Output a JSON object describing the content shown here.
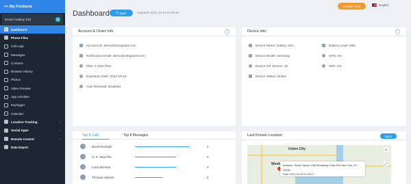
{
  "sidebar": {
    "back_label": "<< My Products",
    "device_name": "Device Galaxy S10",
    "items": [
      {
        "label": "Dashboard",
        "active": true,
        "bold": true,
        "arrow": false,
        "icon": "dashboard-icon"
      },
      {
        "label": "Phone Files",
        "bold": true,
        "arrow": true,
        "icon": "phone-files-icon"
      },
      {
        "label": "Call Logs",
        "icon": "call-icon"
      },
      {
        "label": "Messages",
        "icon": "message-icon"
      },
      {
        "label": "Contacts",
        "icon": "contacts-icon"
      },
      {
        "label": "Browser History",
        "icon": "browser-icon"
      },
      {
        "label": "Photos",
        "icon": "photo-icon"
      },
      {
        "label": "Video Preview",
        "icon": "video-icon"
      },
      {
        "label": "App Activities",
        "icon": "apps-icon"
      },
      {
        "label": "Keylogger",
        "icon": "keyboard-icon"
      },
      {
        "label": "Calendar",
        "icon": "calendar-icon"
      },
      {
        "label": "Location Tracking",
        "bold": true,
        "arrow": true,
        "icon": "location-icon"
      },
      {
        "label": "Social Apps",
        "bold": true,
        "arrow": true,
        "icon": "social-icon"
      },
      {
        "label": "Remote Control",
        "bold": true,
        "arrow": true,
        "icon": "remote-icon"
      },
      {
        "label": "Data Export",
        "bold": true,
        "arrow": false,
        "icon": "export-icon"
      }
    ]
  },
  "header": {
    "title": "Dashboard",
    "sync_label": "Sync",
    "updated": "Updated: 2021-10-19 11:00:39",
    "monitor_label": "Monitor Now",
    "language": "English"
  },
  "account": {
    "title": "Account & Order Info",
    "rows": [
      "Account ID: demo@clevguard.com",
      "Notification Email: demo@clevguard.com",
      "Plan: 1-Year Plan",
      "Expiration Date: 2022-10-19",
      "Auto Renewal: Disabled"
    ]
  },
  "device": {
    "title": "Device Info",
    "left": [
      "Device Name: Galaxy S10",
      "Device Model: samsung",
      "Device OS Version: 10",
      "Device Status: Online"
    ],
    "right": [
      "Battery Level: 59%",
      "GPS: On",
      "WiFi: On"
    ]
  },
  "calls": {
    "tab_active": "Top 8 Calls",
    "tab_other": "Top 8 Messages",
    "rows": [
      {
        "name": "David Rudolph",
        "count": "4",
        "bar": 1.0
      },
      {
        "name": "H. K. Skip Pile",
        "count": "3",
        "bar": 0.75
      },
      {
        "name": "Louis Benson",
        "count": "3",
        "bar": 0.75
      },
      {
        "name": "Thomas Harmer",
        "count": "2",
        "bar": 0.5
      }
    ]
  },
  "location": {
    "title": "Last Known Location",
    "sync_label": "Sync",
    "map_label": "Union City",
    "map_label2": "Weeh",
    "address": "Address: Times Square,1560 Broadway Suite 800 New York, NY 10036",
    "date": "Date: 2021-01-20 14:23:37"
  },
  "colors": {
    "accent": "#2f9ee8",
    "sidebar_bg": "#1d2733",
    "monitor": "#f29a2e"
  }
}
